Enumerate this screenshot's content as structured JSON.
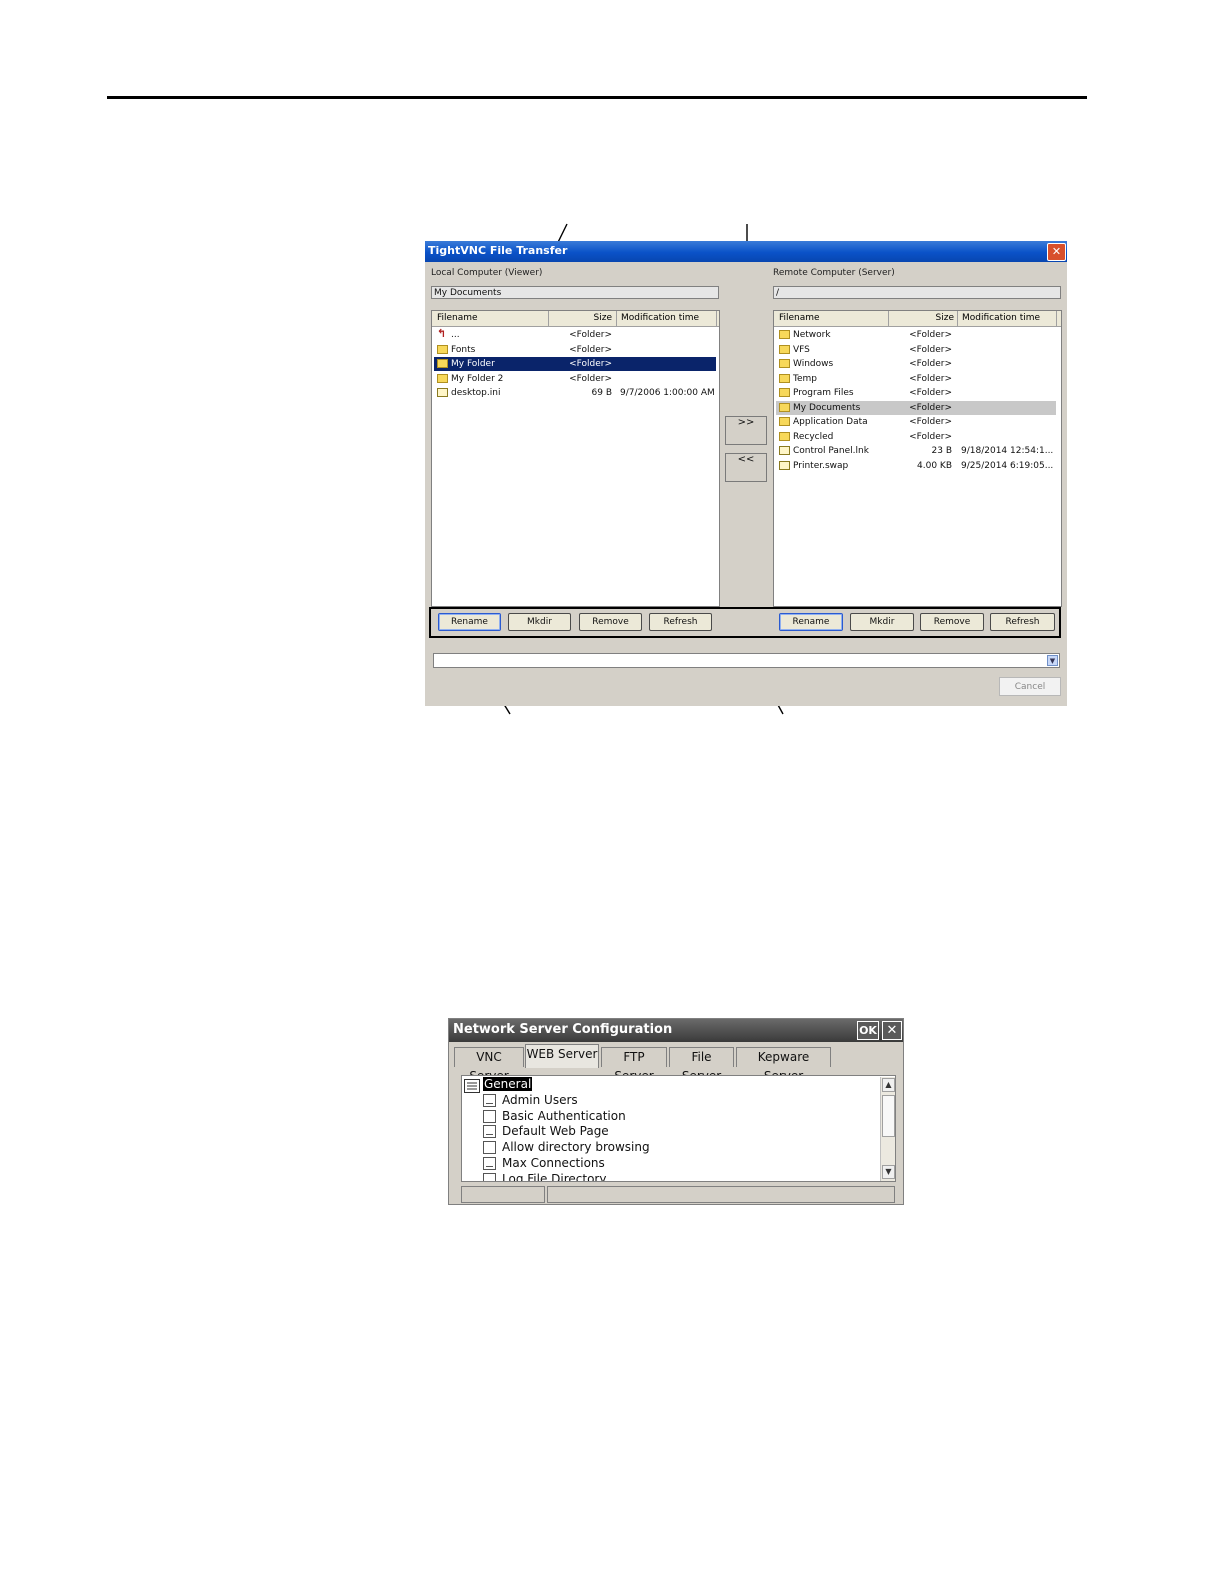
{
  "vnc": {
    "title": "TightVNC File Transfer",
    "close_glyph": "✕",
    "local_label": "Local Computer (Viewer)",
    "remote_label": "Remote Computer (Server)",
    "local_path": "My Documents",
    "remote_path": "/",
    "columns": {
      "filename": "Filename",
      "size": "Size",
      "modified": "Modification time"
    },
    "local_files": [
      {
        "name": "...",
        "size": "<Folder>",
        "modified": "",
        "icon": "up-icon"
      },
      {
        "name": "Fonts",
        "size": "<Folder>",
        "modified": "",
        "icon": "folder-icon"
      },
      {
        "name": "My Folder",
        "size": "<Folder>",
        "modified": "",
        "icon": "folder-icon",
        "selected": true
      },
      {
        "name": "My Folder 2",
        "size": "<Folder>",
        "modified": "",
        "icon": "folder-icon"
      },
      {
        "name": "desktop.ini",
        "size": "69 B",
        "modified": "9/7/2006 1:00:00 AM",
        "icon": "file-icon"
      }
    ],
    "remote_files": [
      {
        "name": "Network",
        "size": "<Folder>",
        "modified": "",
        "icon": "folder-icon"
      },
      {
        "name": "VFS",
        "size": "<Folder>",
        "modified": "",
        "icon": "folder-icon"
      },
      {
        "name": "Windows",
        "size": "<Folder>",
        "modified": "",
        "icon": "folder-icon"
      },
      {
        "name": "Temp",
        "size": "<Folder>",
        "modified": "",
        "icon": "folder-icon"
      },
      {
        "name": "Program Files",
        "size": "<Folder>",
        "modified": "",
        "icon": "folder-icon"
      },
      {
        "name": "My Documents",
        "size": "<Folder>",
        "modified": "",
        "icon": "folder-icon",
        "highlighted": true
      },
      {
        "name": "Application Data",
        "size": "<Folder>",
        "modified": "",
        "icon": "folder-icon"
      },
      {
        "name": "Recycled",
        "size": "<Folder>",
        "modified": "",
        "icon": "folder-icon"
      },
      {
        "name": "Control Panel.lnk",
        "size": "23 B",
        "modified": "9/18/2014 12:54:1...",
        "icon": "file-icon"
      },
      {
        "name": "Printer.swap",
        "size": "4.00 KB",
        "modified": "9/25/2014 6:19:05...",
        "icon": "file-icon"
      }
    ],
    "upload_label": ">>",
    "download_label": "<<",
    "buttons": {
      "rename": "Rename",
      "mkdir": "Mkdir",
      "remove": "Remove",
      "refresh": "Refresh"
    },
    "combo_value": "",
    "cancel_label": "Cancel"
  },
  "nsc": {
    "title": "Network Server Configuration",
    "ok_label": "OK",
    "close_glyph": "✕",
    "tabs": [
      "VNC Server",
      "WEB Server",
      "FTP Server",
      "File Server",
      "Kepware Server"
    ],
    "active_tab": 1,
    "tree_root": "General",
    "tree_items": [
      "Admin Users",
      "Basic Authentication",
      "Default Web Page",
      "Allow directory browsing",
      "Max Connections",
      "Log File Directory"
    ]
  }
}
